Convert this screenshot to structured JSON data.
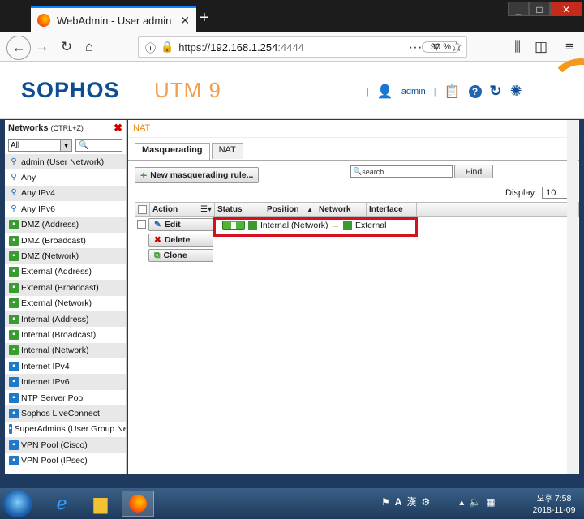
{
  "browser": {
    "tab_title": "WebAdmin - User admin - De",
    "new_tab": "+",
    "url_scheme": "https://",
    "url_host": "192.168.1.254",
    "url_port": ":4444",
    "zoom": "90 %",
    "window_buttons": {
      "minimize": "_",
      "maximize": "□",
      "close": "✕"
    }
  },
  "header": {
    "logo": "SOPHOS",
    "product": "UTM 9",
    "user": "admin",
    "icons": [
      "user-icon",
      "clipboard-icon",
      "help-icon",
      "reload-icon",
      "spinner-icon"
    ]
  },
  "left_panel": {
    "title": "Networks",
    "shortcut": "(CTRL+Z)",
    "filter_value": "All",
    "items": [
      {
        "label": "admin (User Network)",
        "icon": "user"
      },
      {
        "label": "Any",
        "icon": "user"
      },
      {
        "label": "Any IPv4",
        "icon": "user"
      },
      {
        "label": "Any IPv6",
        "icon": "user"
      },
      {
        "label": "DMZ (Address)",
        "icon": "green"
      },
      {
        "label": "DMZ (Broadcast)",
        "icon": "green"
      },
      {
        "label": "DMZ (Network)",
        "icon": "green"
      },
      {
        "label": "External (Address)",
        "icon": "green"
      },
      {
        "label": "External (Broadcast)",
        "icon": "green"
      },
      {
        "label": "External (Network)",
        "icon": "green"
      },
      {
        "label": "Internal (Address)",
        "icon": "green"
      },
      {
        "label": "Internal (Broadcast)",
        "icon": "green"
      },
      {
        "label": "Internal (Network)",
        "icon": "green"
      },
      {
        "label": "Internet IPv4",
        "icon": "blue"
      },
      {
        "label": "Internet IPv6",
        "icon": "blue"
      },
      {
        "label": "NTP Server Pool",
        "icon": "blue"
      },
      {
        "label": "Sophos LiveConnect",
        "icon": "blue"
      },
      {
        "label": "SuperAdmins (User Group Ne",
        "icon": "blue"
      },
      {
        "label": "VPN Pool (Cisco)",
        "icon": "blue"
      },
      {
        "label": "VPN Pool (IPsec)",
        "icon": "blue"
      }
    ]
  },
  "main": {
    "breadcrumb": "NAT",
    "tabs": [
      {
        "label": "Masquerading",
        "active": true
      },
      {
        "label": "NAT",
        "active": false
      }
    ],
    "new_button": "New masquerading rule...",
    "search_placeholder": "search",
    "find_button": "Find",
    "display_label": "Display:",
    "display_value": "10",
    "columns": {
      "action": "Action",
      "status": "Status",
      "position": "Position",
      "network": "Network",
      "interface": "Interface"
    },
    "row": {
      "edit": "Edit",
      "delete": "Delete",
      "clone": "Clone",
      "network": "Internal (Network)",
      "arrow": "→",
      "interface": "External",
      "enabled": true
    }
  },
  "taskbar": {
    "ime_a": "A",
    "ime_han": "漢",
    "time_label": "오후 7:58",
    "date": "2018-11-09"
  },
  "colors": {
    "brand": "#0e4d92",
    "accent": "#e8850c",
    "highlight": "#d4121d"
  }
}
